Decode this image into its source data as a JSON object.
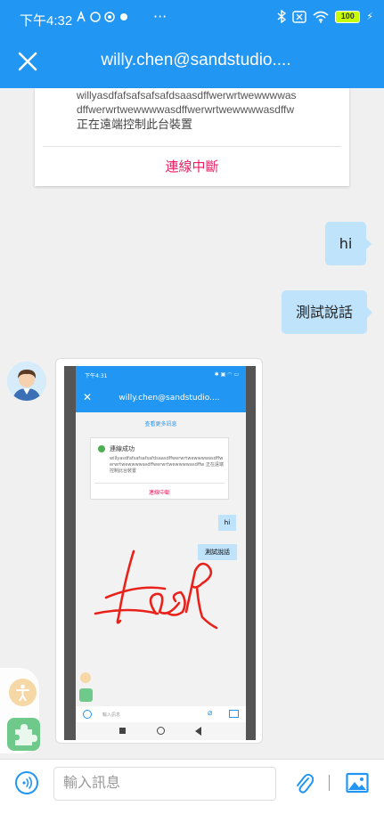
{
  "status_bar": {
    "time": "下午4:32",
    "more": "···",
    "battery": "100"
  },
  "app_bar": {
    "title": "willy.chen@sandstudio...."
  },
  "connection_card": {
    "message_line1": "willyasdfafsafsafsafdsaasdffwerwrtwewwwwas",
    "message_line2": "dffwerwrtwewwwwasdffwerwrtwewwwwasdffw",
    "message_line3": "正在遠端控制此台裝置",
    "disconnect_label": "連線中斷"
  },
  "messages": [
    {
      "text": "hi"
    },
    {
      "text": "測試說話"
    }
  ],
  "screenshot_message": {
    "status_time": "下午4:31",
    "title": "willy.chen@sandstudio....",
    "load_more": "查看更多訊息",
    "connected": "連線成功",
    "card_text": "willyasdfafsafsafsafdsaasdffwerwrtwewwwwasdffwerwrtwewwwwasdffwerwrtwewwwwasdffw 正在遠端控制此台裝置",
    "disconnect": "連線中斷",
    "bubble1": "hi",
    "bubble2": "測試說話",
    "input_placeholder": "輸入訊息"
  },
  "input_bar": {
    "placeholder": "輸入訊息"
  },
  "colors": {
    "primary": "#2196f3",
    "bubble": "#bfe3fb",
    "disconnect": "#e91e63"
  }
}
